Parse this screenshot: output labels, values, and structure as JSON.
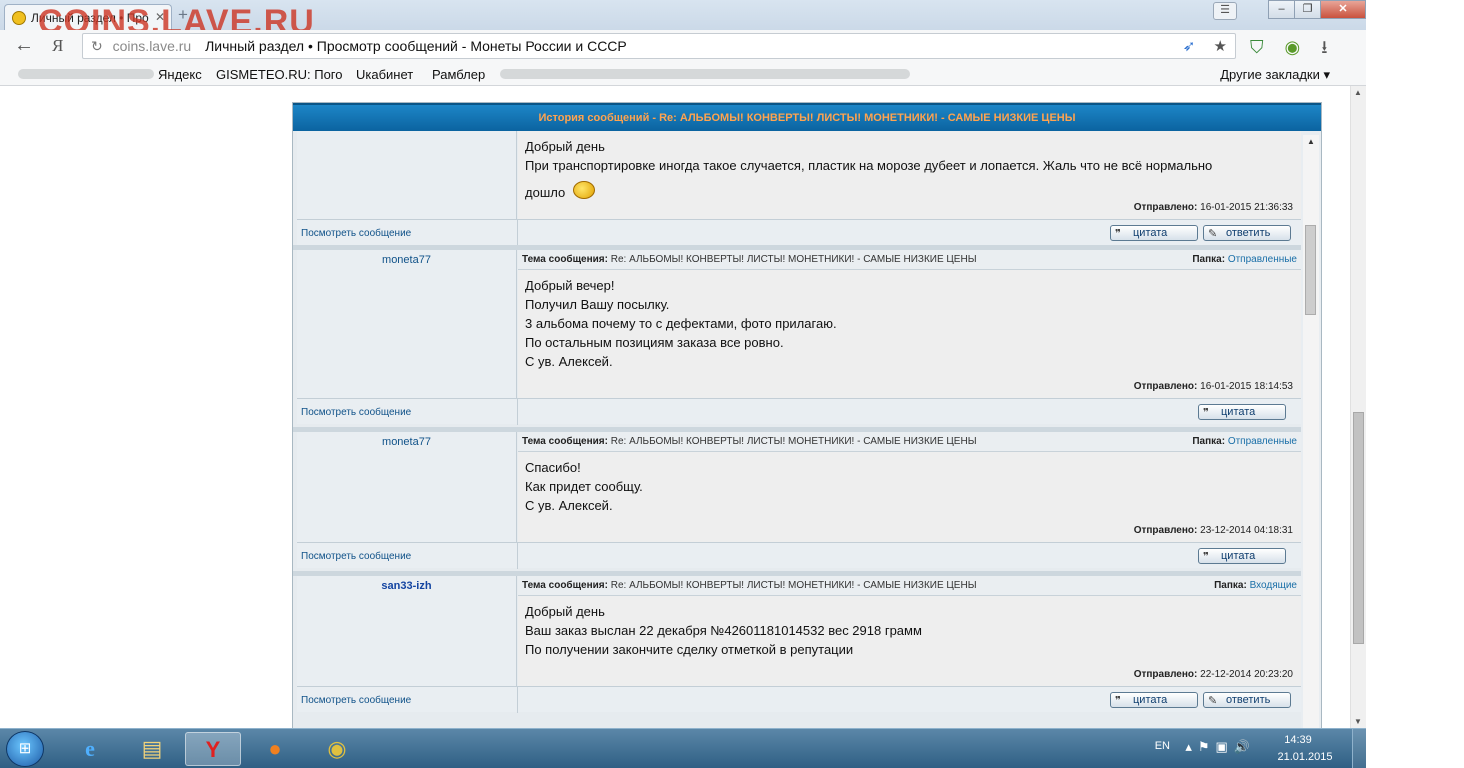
{
  "browser": {
    "tab_title": "Личный раздел • Про",
    "watermark": "COINS.LAVE.RU",
    "address_domain": "coins.lave.ru",
    "address_title": "Личный раздел • Просмотр сообщений - Монеты России и СССР",
    "bookmarks": [
      "Яндекс",
      "GISMETEO.RU: Пого",
      "Uкабинет",
      "Рамблер"
    ],
    "other_bookmarks": "Другие закладки ▾"
  },
  "panel": {
    "header": "История сообщений - Re: АЛЬБОМЫ! КОНВЕРТЫ! ЛИСТЫ! МОНЕТНИКИ! - САМЫЕ НИЗКИЕ ЦЕНЫ"
  },
  "labels": {
    "subject": "Тема сообщения:",
    "folder": "Папка:",
    "sent": "Отправлено:",
    "view_message": "Посмотреть сообщение",
    "quote": "цитата",
    "reply": "ответить"
  },
  "messages": [
    {
      "text": [
        "Добрый день",
        "При транспортировке иногда такое случается, пластик на морозе дубеет и лопается. Жаль что не всё нормально",
        "дошло"
      ],
      "sent": "16-01-2015 21:36:33"
    },
    {
      "author": "moneta77",
      "subject": "Re: АЛЬБОМЫ! КОНВЕРТЫ! ЛИСТЫ! МОНЕТНИКИ! - САМЫЕ НИЗКИЕ ЦЕНЫ",
      "folder": "Отправленные",
      "text": [
        "Добрый вечер!",
        "Получил Вашу посылку.",
        "3 альбома почему то с дефектами, фото прилагаю.",
        "По остальным позициям заказа все ровно.",
        "С ув. Алексей."
      ],
      "sent": "16-01-2015 18:14:53"
    },
    {
      "author": "moneta77",
      "subject": "Re: АЛЬБОМЫ! КОНВЕРТЫ! ЛИСТЫ! МОНЕТНИКИ! - САМЫЕ НИЗКИЕ ЦЕНЫ",
      "folder": "Отправленные",
      "text": [
        "Спасибо!",
        "Как придет сообщу.",
        "С ув. Алексей."
      ],
      "sent": "23-12-2014 04:18:31"
    },
    {
      "author": "san33-izh",
      "subject": "Re: АЛЬБОМЫ! КОНВЕРТЫ! ЛИСТЫ! МОНЕТНИКИ! - САМЫЕ НИЗКИЕ ЦЕНЫ",
      "folder": "Входящие",
      "text": [
        "Добрый день",
        "Ваш заказ выслан 22 декабря №42601181014532 вес 2918 грамм",
        "По получении закончите сделку отметкой в репутации"
      ],
      "sent": "22-12-2014 20:23:20"
    }
  ],
  "taskbar": {
    "lang": "EN",
    "time": "14:39",
    "date": "21.01.2015"
  }
}
